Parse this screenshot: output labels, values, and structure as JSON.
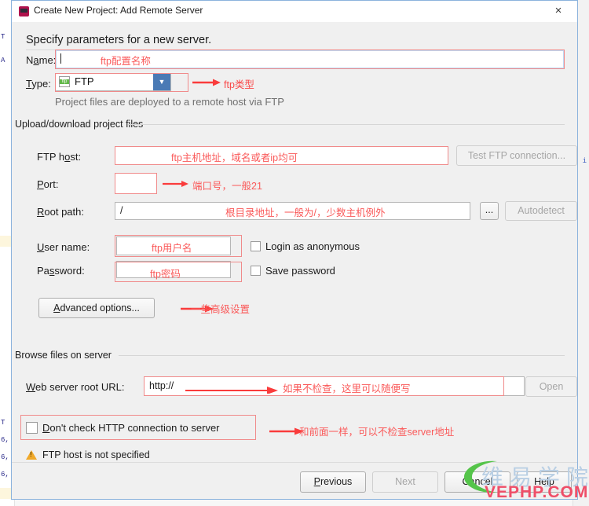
{
  "window": {
    "title": "Create New Project: Add Remote Server",
    "close_label": "×",
    "headline": "Specify parameters for a new server."
  },
  "form": {
    "name_label": "Name:",
    "name_value": "",
    "type_label": "Type:",
    "type_value": "FTP",
    "type_icon": "ftp-file-icon",
    "type_hint": "Project files are deployed to a remote host via FTP"
  },
  "upload_group": {
    "title": "Upload/download project files",
    "ftp_host_label": "FTP host:",
    "ftp_host_value": "",
    "test_button": "Test FTP connection...",
    "port_label": "Port:",
    "port_value": "",
    "root_path_label": "Root path:",
    "root_path_value": "/",
    "browse_button": "...",
    "autodetect_button": "Autodetect",
    "user_name_label": "User name:",
    "user_name_value": "",
    "login_anonymous_label": "Login as anonymous",
    "login_anonymous_checked": false,
    "password_label": "Password:",
    "password_value": "",
    "save_password_label": "Save password",
    "save_password_checked": false,
    "advanced_button": "Advanced options..."
  },
  "browse_group": {
    "title": "Browse files on server",
    "web_url_label": "Web server root URL:",
    "web_url_value": "http://",
    "open_button": "Open",
    "dont_check_label": "Don't check HTTP connection to server",
    "dont_check_checked": false
  },
  "status": {
    "icon": "warning-triangle-icon",
    "message": "FTP host is not specified"
  },
  "footer": {
    "previous": "Previous",
    "next": "Next",
    "cancel": "Cancel",
    "help": "Help"
  },
  "annotations": {
    "name_note": "ftp配置名称",
    "type_note": "ftp类型",
    "host_note": "ftp主机地址，域名或者ip均可",
    "port_note": "端口号，一般21",
    "root_note": "根目录地址，一般为/，少数主机例外",
    "user_note": "ftp用户名",
    "password_note": "ftp密码",
    "advanced_note": "一些高级设置",
    "weburl_note": "如果不检查，这里可以随便写",
    "dontcheck_note": "和前面一样，可以不检查server地址"
  },
  "watermark": {
    "chinese": "维易学院",
    "domain": "VEPHP.COM"
  },
  "background": {
    "gutter": [
      "T",
      "A",
      "T",
      "6,",
      "6,",
      "6,"
    ],
    "right_marks": [
      "i"
    ]
  },
  "colors": {
    "annotation_red": "#fa5a5a",
    "annotation_box": "#f08b8b",
    "dialog_bg": "#f0f0f0",
    "accent_blue": "#4a7ab5",
    "warning_orange": "#f0a92a"
  }
}
